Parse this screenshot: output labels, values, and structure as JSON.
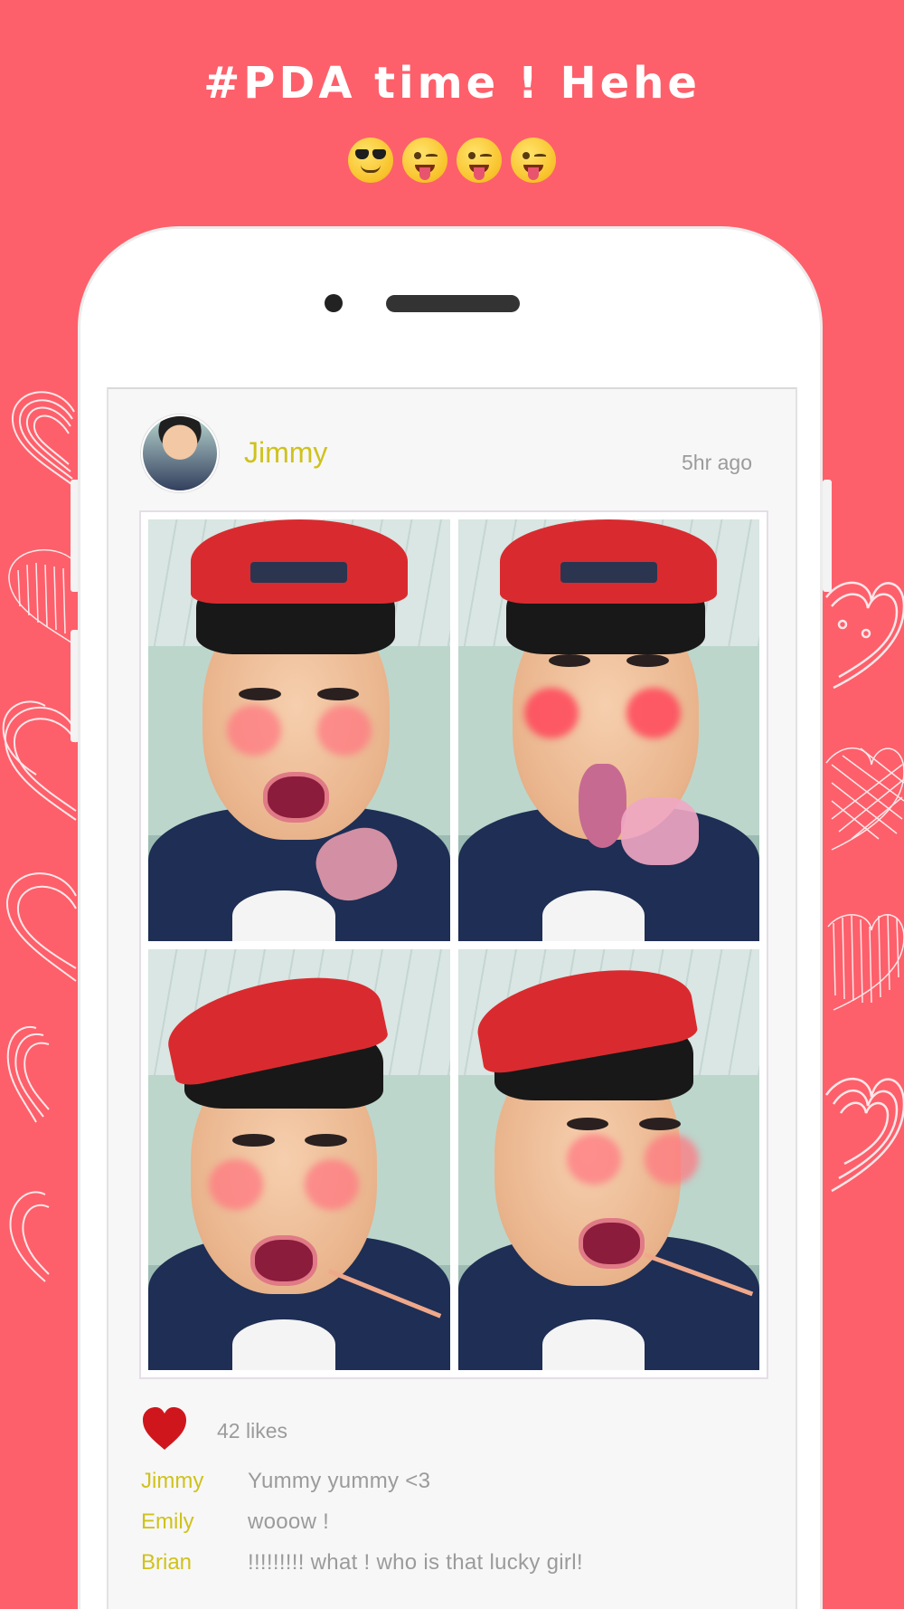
{
  "header": {
    "title": "#PDA time ! Hehe",
    "emojis": [
      "sunglasses-emoji",
      "winking-tongue-emoji",
      "winking-tongue-emoji",
      "winking-tongue-emoji"
    ]
  },
  "colors": {
    "background": "#fd606b",
    "username": "#cfc21c",
    "muted_text": "#9b9b9b",
    "like_heart": "#d0161d"
  },
  "post": {
    "user": "Jimmy",
    "time_ago": "5hr ago",
    "photos": [
      "photo-1",
      "photo-2",
      "photo-3",
      "photo-4"
    ],
    "likes": "42 likes",
    "comments": [
      {
        "user": "Jimmy",
        "text": "Yummy yummy <3"
      },
      {
        "user": "Emily",
        "text": "wooow !"
      },
      {
        "user": "Brian",
        "text": "!!!!!!!!! what ! who is that lucky girl!"
      }
    ]
  }
}
